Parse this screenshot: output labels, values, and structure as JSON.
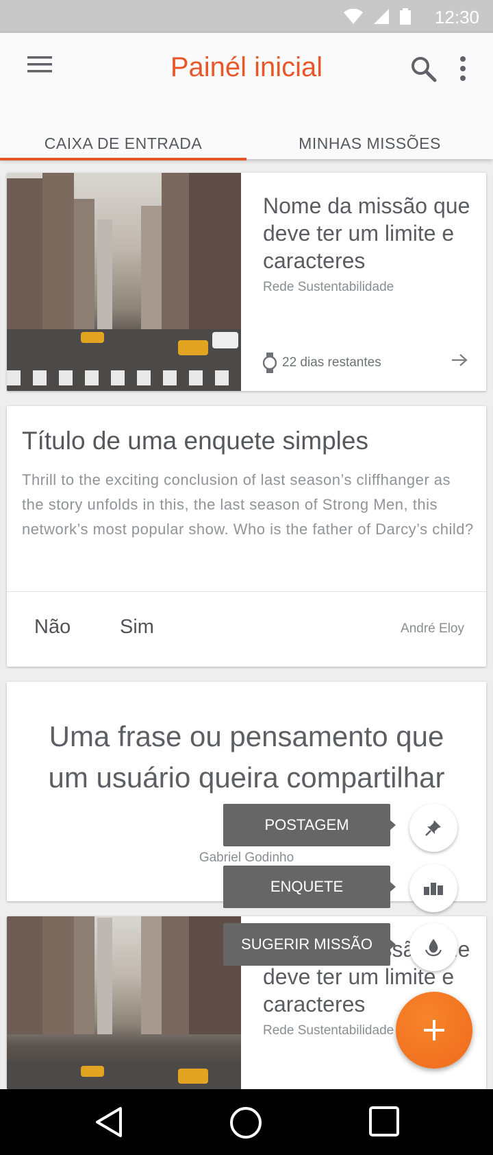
{
  "status_bar": {
    "time": "12:30"
  },
  "app_bar": {
    "title": "Painél inicial"
  },
  "tabs": [
    {
      "label": "CAIXA DE ENTRADA",
      "active": true
    },
    {
      "label": "MINHAS MISSÕES",
      "active": false
    }
  ],
  "mission_card": {
    "title": "Nome da missão que deve ter um limite e caracteres",
    "network": "Rede Sustentabilidade",
    "days_left": "22 dias restantes"
  },
  "poll_card": {
    "title": "Título de uma enquete simples",
    "text": "Thrill to the exciting conclusion of last season’s cliffhanger as the story unfolds in this, the last season of Strong Men, this network’s most popular show. Who is the father of Darcy’s child?",
    "options": [
      "Não",
      "Sim"
    ],
    "author": "André  Eloy"
  },
  "quote_card": {
    "text": "Uma frase ou pensamento que um usuário queira compartilhar",
    "author": "Gabriel Godinho"
  },
  "mission_card_2": {
    "title": "Nome da missão que deve ter um limite e caracteres",
    "network": "Rede Sustentabilidade"
  },
  "fab_menu": {
    "items": [
      {
        "label": "POSTAGEM",
        "icon": "pin-icon"
      },
      {
        "label": "ENQUETE",
        "icon": "poll-icon"
      },
      {
        "label": "SUGERIR MISSÃO",
        "icon": "mission-drop-icon"
      }
    ],
    "main_icon": "plus-icon"
  },
  "colors": {
    "accent": "#e8572a",
    "fab": "#ef6a1d",
    "status_bar": "#c8c8c8",
    "tooltip": "#666666"
  }
}
